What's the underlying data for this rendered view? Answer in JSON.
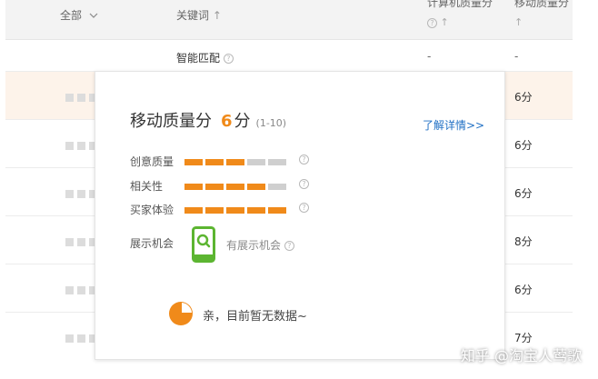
{
  "header": {
    "all_label": "全部",
    "keyword_label": "关键词",
    "pc_quality_label": "计算机质量分",
    "mobile_quality_label": "移动质量分"
  },
  "rows": [
    {
      "keyword": "智能匹配",
      "pc": "-",
      "mobile": "-"
    },
    {
      "score": "6分"
    },
    {
      "score": "6分"
    },
    {
      "score": "6分"
    },
    {
      "score": "8分"
    },
    {
      "score": "6分"
    },
    {
      "score": "7分"
    }
  ],
  "popup": {
    "title": "移动质量分",
    "score": "6",
    "unit": "分",
    "range": "(1-10)",
    "link": "了解详情>>",
    "metrics": [
      {
        "label": "创意质量",
        "level": 3,
        "max": 5
      },
      {
        "label": "相关性",
        "level": 4,
        "max": 5
      },
      {
        "label": "买家体验",
        "level": 5,
        "max": 5
      }
    ],
    "exposure_label": "展示机会",
    "exposure_status": "有展示机会",
    "no_data": "亲，目前暂无数据~"
  },
  "colors": {
    "accent": "#f08a1a",
    "link": "#1f6fc4",
    "phone": "#5cb531"
  },
  "watermark": "知乎 @淘宝人莺歌"
}
